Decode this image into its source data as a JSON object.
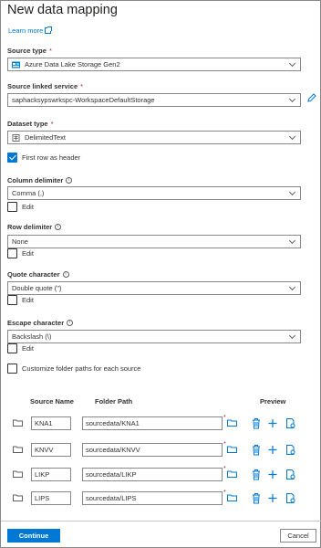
{
  "title": "New data mapping",
  "learn_more": "Learn more",
  "source_type": {
    "label": "Source type",
    "value": "Azure Data Lake Storage Gen2"
  },
  "linked_service": {
    "label": "Source linked service",
    "value": "saphacksypswrkspc-WorkspaceDefaultStorage"
  },
  "dataset_type": {
    "label": "Dataset type",
    "value": "DelimitedText"
  },
  "first_row_header": {
    "label": "First row as header",
    "checked": true
  },
  "column_delimiter": {
    "label": "Column delimiter",
    "value": "Comma (,)",
    "edit": "Edit"
  },
  "row_delimiter": {
    "label": "Row delimiter",
    "value": "None",
    "edit": "Edit"
  },
  "quote_character": {
    "label": "Quote character",
    "value": "Double quote (\")",
    "edit": "Edit"
  },
  "escape_character": {
    "label": "Escape character",
    "value": "Backslash (\\)",
    "edit": "Edit"
  },
  "customize_paths": {
    "label": "Customize folder paths for each source",
    "checked": false
  },
  "required_mark": "*",
  "info_glyph": "i",
  "table": {
    "headers": {
      "source_name": "Source Name",
      "folder_path": "Folder Path",
      "preview": "Preview"
    },
    "rows": [
      {
        "source": "KNA1",
        "path": "sourcedata/KNA1"
      },
      {
        "source": "KNVV",
        "path": "sourcedata/KNVV"
      },
      {
        "source": "LIKP",
        "path": "sourcedata/LIKP"
      },
      {
        "source": "LIPS",
        "path": "sourcedata/LIPS"
      }
    ]
  },
  "footer": {
    "continue": "Continue",
    "cancel": "Cancel"
  },
  "colors": {
    "accent": "#0078d4",
    "required": "#a4262c",
    "border": "#8a8886"
  }
}
